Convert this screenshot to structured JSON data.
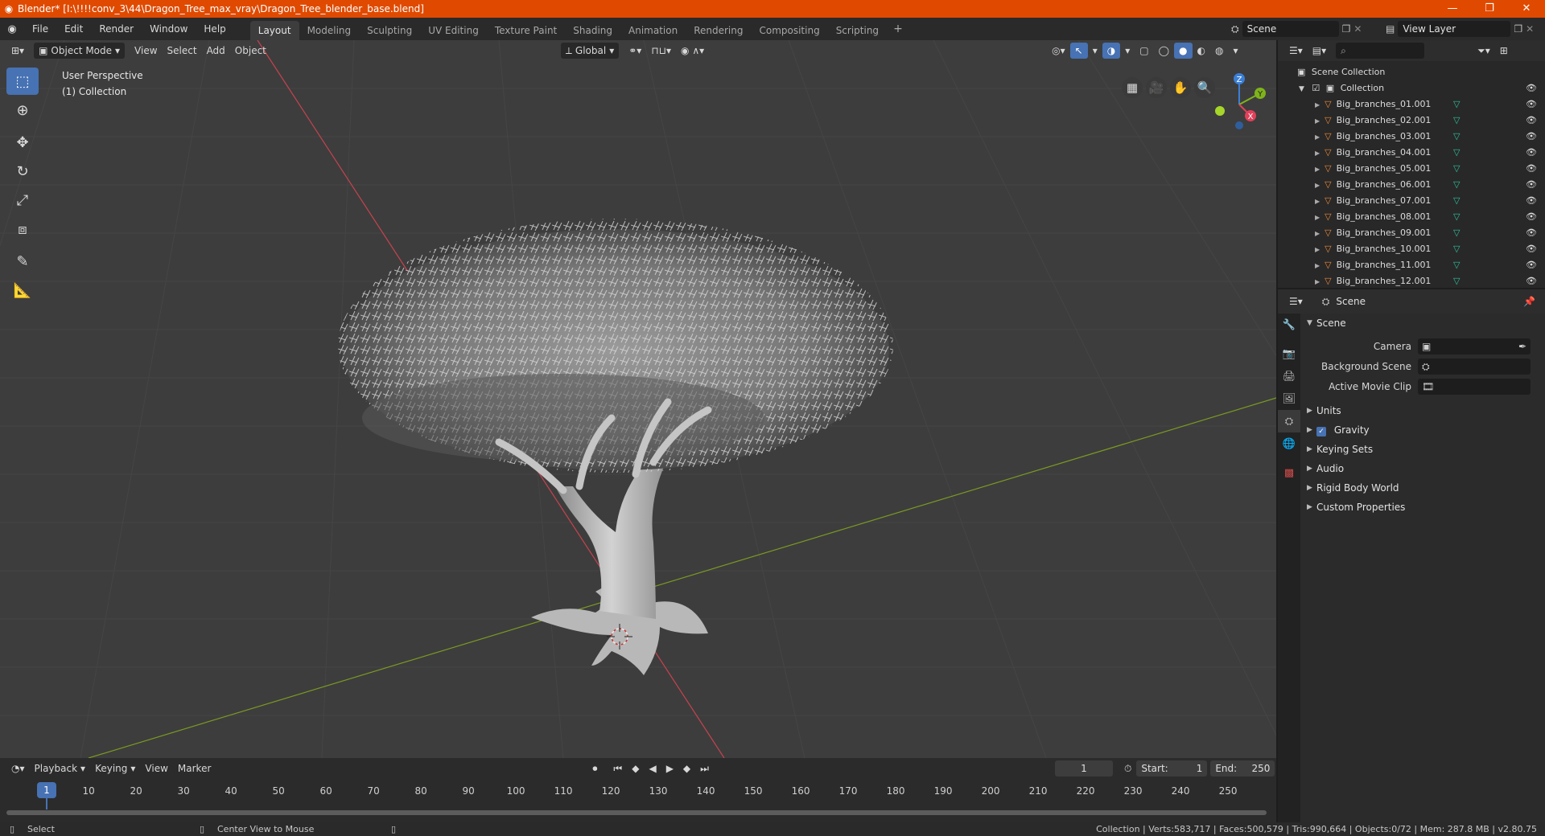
{
  "window": {
    "title": "Blender* [I:\\!!!!conv_3\\44\\Dragon_Tree_max_vray\\Dragon_Tree_blender_base.blend]",
    "minimize": "—",
    "maximize": "❐",
    "close": "✕"
  },
  "menu": {
    "items": [
      "File",
      "Edit",
      "Render",
      "Window",
      "Help"
    ]
  },
  "workspaces": {
    "tabs": [
      "Layout",
      "Modeling",
      "Sculpting",
      "UV Editing",
      "Texture Paint",
      "Shading",
      "Animation",
      "Rendering",
      "Compositing",
      "Scripting"
    ],
    "active": "Layout",
    "add": "+"
  },
  "scene_selector": {
    "value": "Scene"
  },
  "view_layer_selector": {
    "value": "View Layer"
  },
  "viewport": {
    "mode": "Object Mode",
    "menus": [
      "View",
      "Select",
      "Add",
      "Object"
    ],
    "orientation": "Global",
    "overlay_line1": "User Perspective",
    "overlay_line2": "(1) Collection",
    "gizmo": {
      "z": "Z",
      "y": "Y",
      "x": "X"
    },
    "colors": {
      "x_axis": "#c8424f",
      "y_axis": "#7a9a22",
      "background": "#3d3d3d",
      "active_tool": "#4772b3"
    }
  },
  "tools": [
    "select-box",
    "cursor",
    "move",
    "rotate",
    "scale",
    "transform",
    "annotate",
    "measure"
  ],
  "timeline": {
    "menus": [
      "Playback",
      "Keying",
      "View",
      "Marker"
    ],
    "current_frame": "1",
    "start_label": "Start:",
    "start": "1",
    "end_label": "End:",
    "end": "250",
    "ticks": [
      "1",
      "10",
      "20",
      "30",
      "40",
      "50",
      "60",
      "70",
      "80",
      "90",
      "100",
      "110",
      "120",
      "130",
      "140",
      "150",
      "160",
      "170",
      "180",
      "190",
      "200",
      "210",
      "220",
      "230",
      "240",
      "250"
    ]
  },
  "outliner": {
    "root": "Scene Collection",
    "collection": "Collection",
    "objects": [
      "Big_branches_01.001",
      "Big_branches_02.001",
      "Big_branches_03.001",
      "Big_branches_04.001",
      "Big_branches_05.001",
      "Big_branches_06.001",
      "Big_branches_07.001",
      "Big_branches_08.001",
      "Big_branches_09.001",
      "Big_branches_10.001",
      "Big_branches_11.001",
      "Big_branches_12.001"
    ]
  },
  "properties": {
    "context": "Scene",
    "scene_panel_title": "Scene",
    "camera_label": "Camera",
    "background_scene_label": "Background Scene",
    "active_movie_clip_label": "Active Movie Clip",
    "panels": [
      "Units",
      "Gravity",
      "Keying Sets",
      "Audio",
      "Rigid Body World",
      "Custom Properties"
    ]
  },
  "statusbar": {
    "left1": "Select",
    "left2": "Center View to Mouse",
    "stats": "Collection | Verts:583,717 | Faces:500,579 | Tris:990,664 | Objects:0/72 | Mem: 287.8 MB | v2.80.75"
  }
}
